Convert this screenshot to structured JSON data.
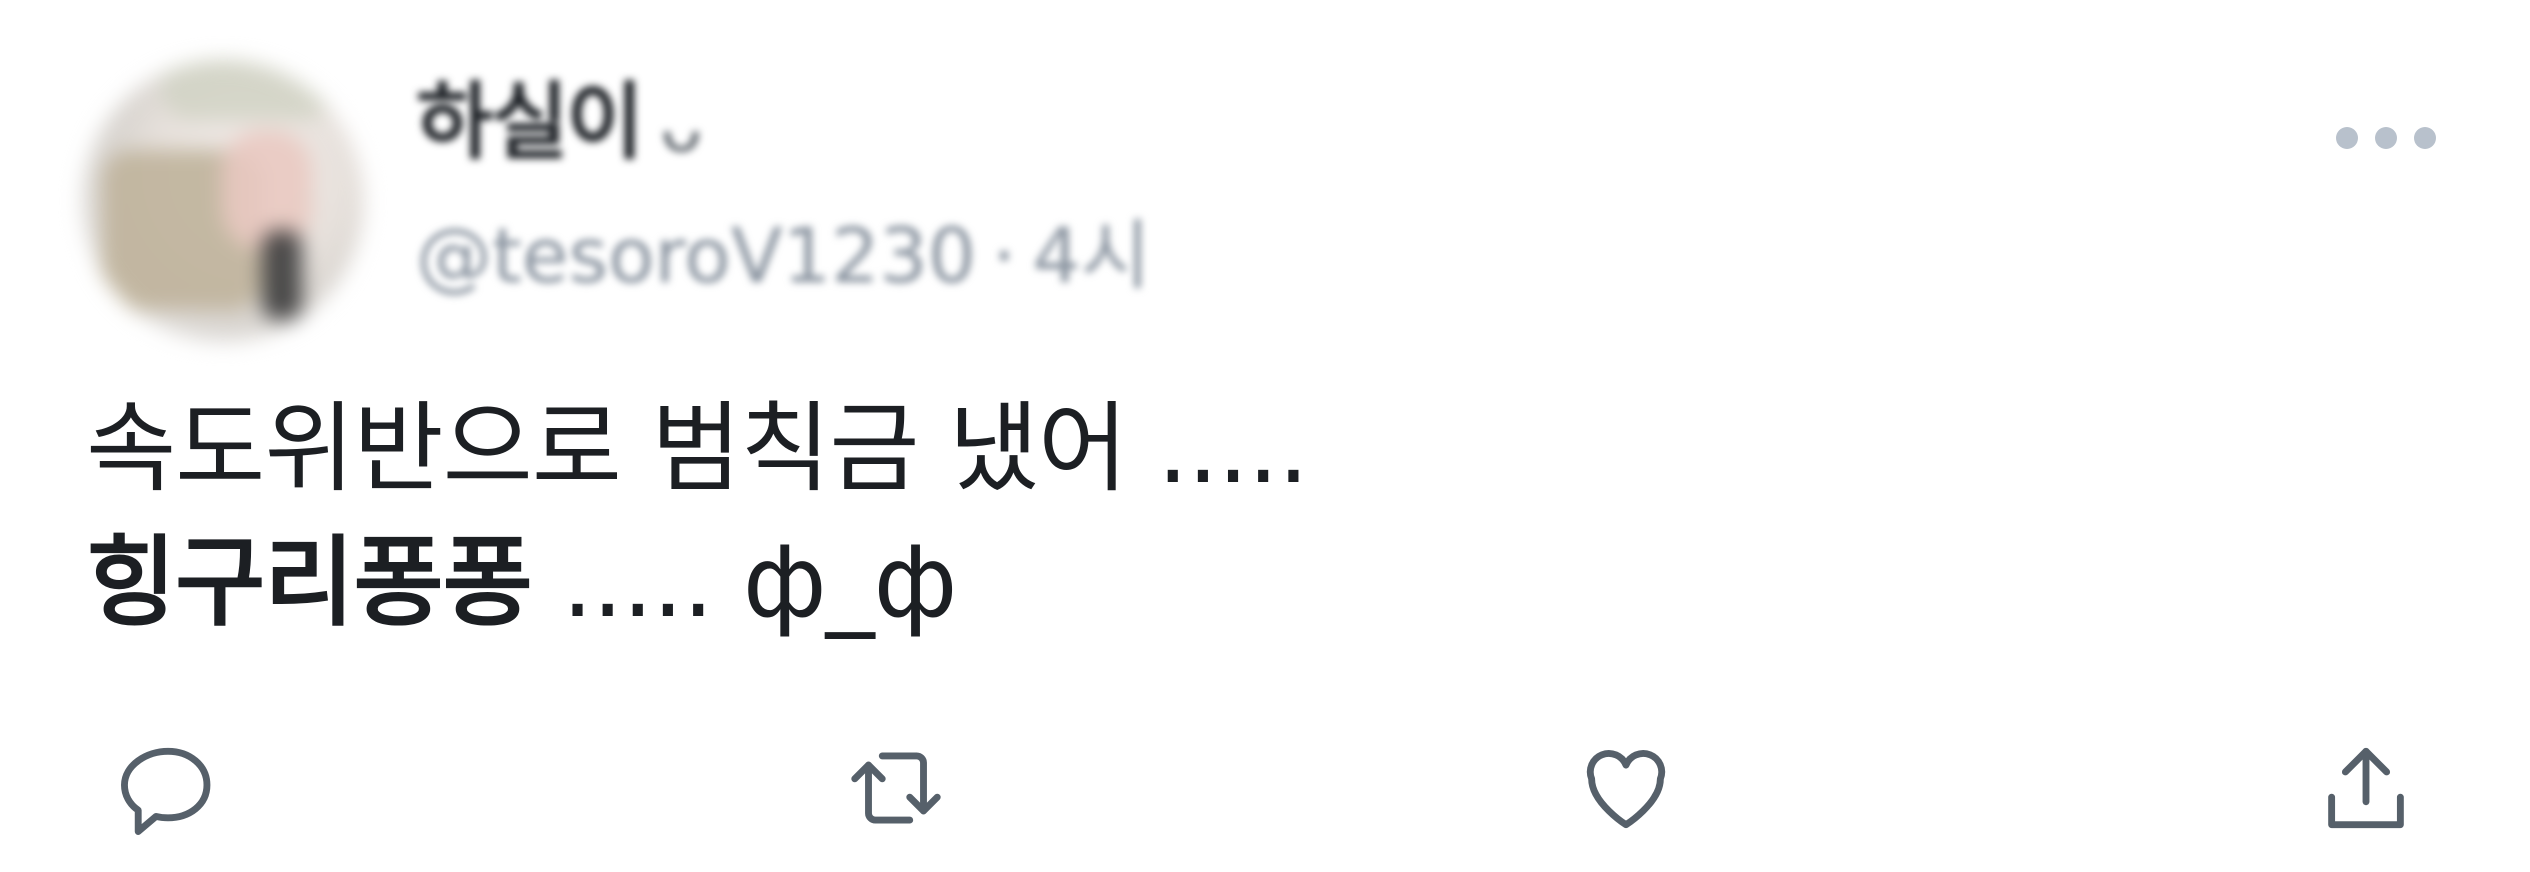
{
  "tweet": {
    "author": {
      "display_name": "하실이",
      "name_emoji": "ᴗ",
      "handle": "@tesoroV1230",
      "separator": "·",
      "timestamp": "4시"
    },
    "text": {
      "line1": "속도위반으로 범칙금 냈어 .....",
      "line2_bold": "힝구리퐁퐁",
      "line2_rest": " ..... ф_ф"
    },
    "actions": {
      "reply_icon": "reply-icon",
      "retweet_icon": "retweet-icon",
      "like_icon": "heart-icon",
      "share_icon": "share-icon"
    },
    "more_icon": "more-horizontal-icon"
  }
}
